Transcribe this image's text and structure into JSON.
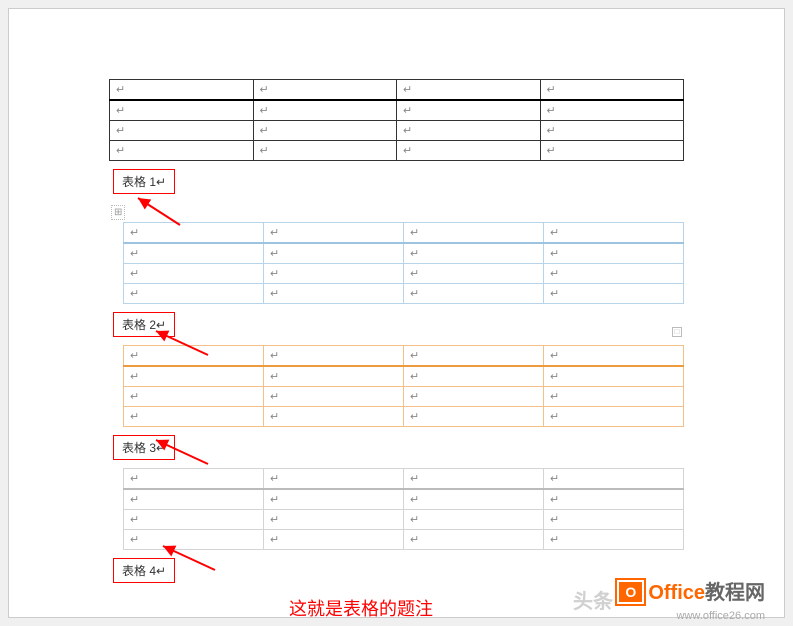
{
  "paragraph_mark": "↵",
  "captions": {
    "c1": "表格 1↵",
    "c2": "表格 2↵",
    "c3": "表格 3↵",
    "c4": "表格 4↵"
  },
  "anchor_symbol": "⊞",
  "annotation_text": "这就是表格的题注",
  "watermark_left": "头条",
  "watermark_office_icon": "O",
  "watermark_text_orange": "Office",
  "watermark_text_gray": "教程网",
  "watermark_url": "www.office26.com",
  "tables": {
    "rows": 4,
    "cols": 4
  }
}
